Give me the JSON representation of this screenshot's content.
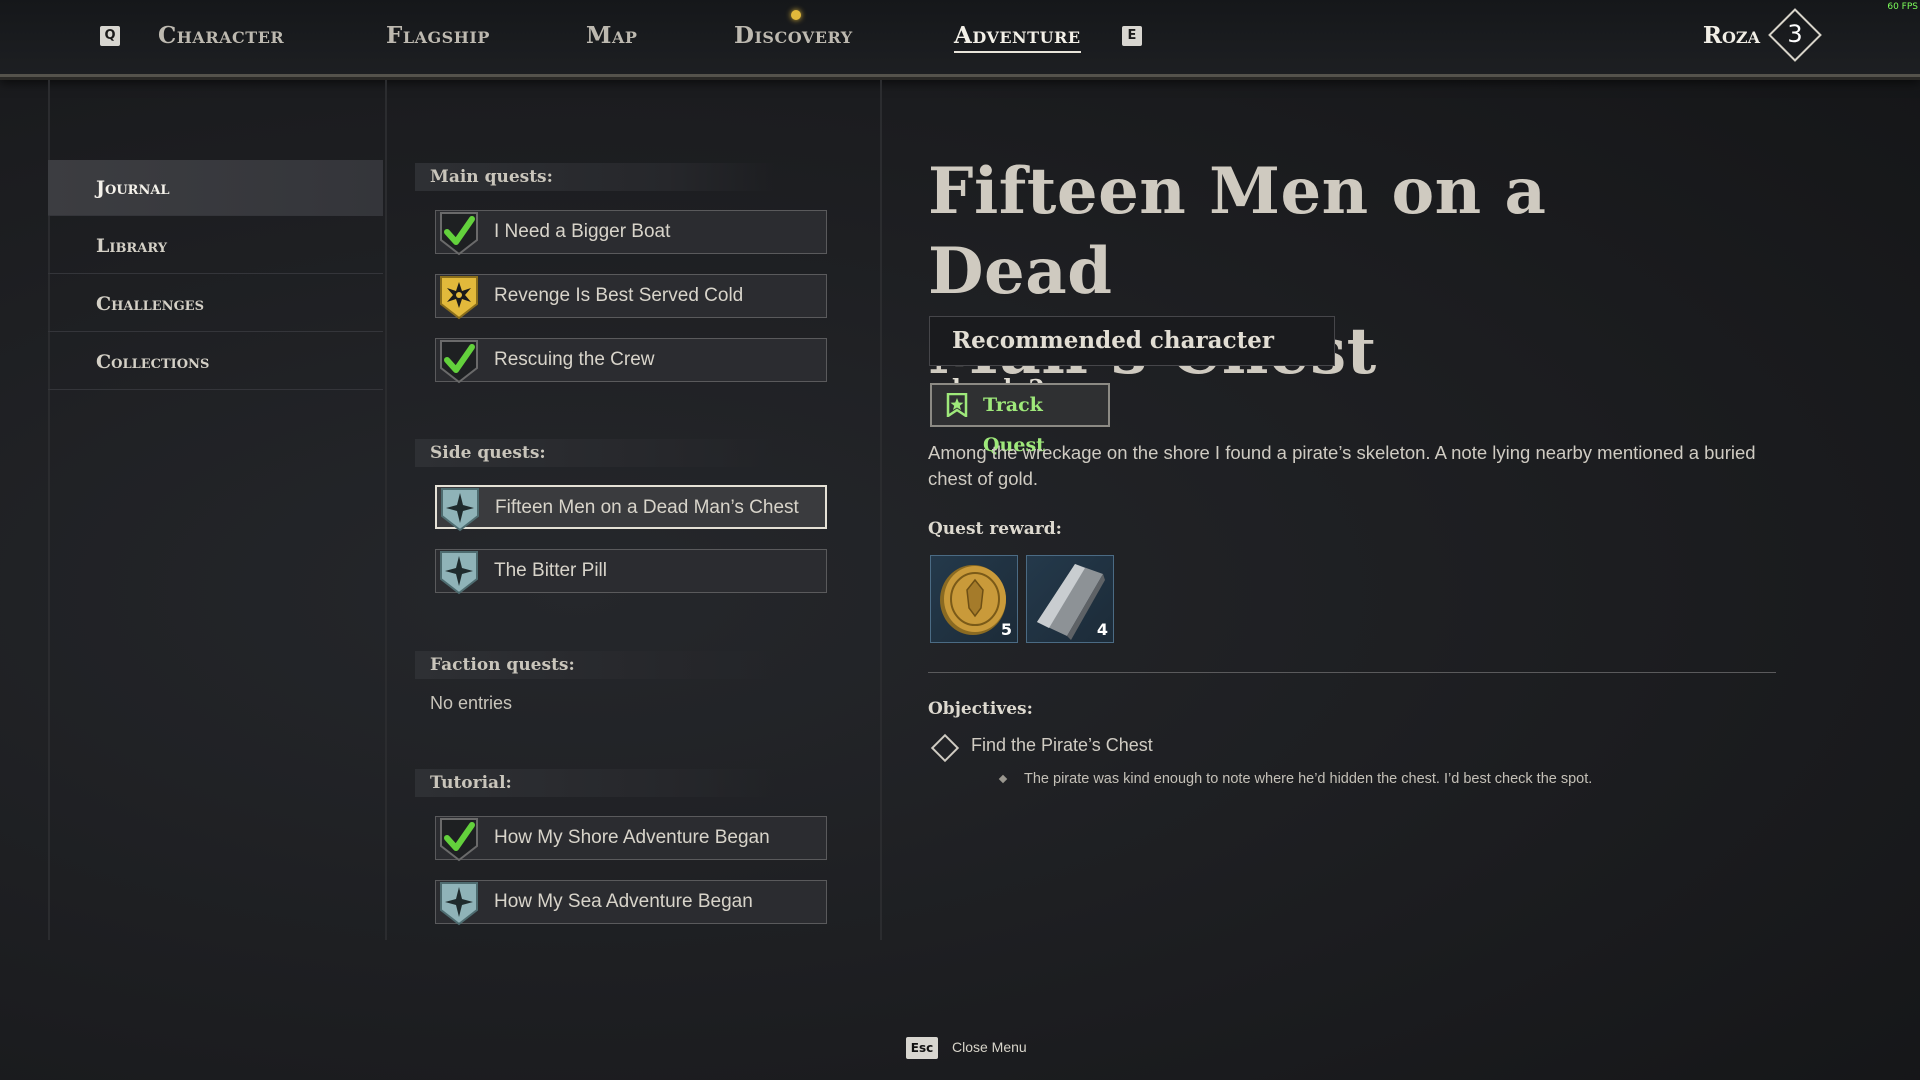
{
  "topbar": {
    "left_key": "Q",
    "right_key": "E",
    "tabs": [
      "Character",
      "Flagship",
      "Map",
      "Discovery",
      "Adventure"
    ],
    "active_tab": "Adventure",
    "player_name": "Roza",
    "player_level": "3",
    "fps": "60 FPS"
  },
  "sidebar": {
    "items": [
      "Journal",
      "Library",
      "Challenges",
      "Collections"
    ],
    "active": "Journal"
  },
  "quests": {
    "main_header": "Main quests:",
    "main": [
      {
        "label": "I Need a Bigger Boat",
        "status": "completed"
      },
      {
        "label": "Revenge Is Best Served Cold",
        "status": "active-main"
      },
      {
        "label": "Rescuing the Crew",
        "status": "completed"
      }
    ],
    "side_header": "Side quests:",
    "side": [
      {
        "label": "Fifteen Men on a Dead Man’s Chest",
        "status": "available",
        "selected": true
      },
      {
        "label": "The Bitter Pill",
        "status": "available"
      }
    ],
    "faction_header": "Faction quests:",
    "faction_empty": "No entries",
    "tutorial_header": "Tutorial:",
    "tutorial": [
      {
        "label": "How My Shore Adventure Began",
        "status": "completed"
      },
      {
        "label": "How My Sea Adventure Began",
        "status": "available"
      }
    ]
  },
  "detail": {
    "title_line1": "Fifteen Men on a Dead",
    "title_line2": "Man’s Chest",
    "recommended_level": "Recommended character level: 2",
    "track_button": "Track Quest",
    "description": "Among the wreckage on the shore I found a pirate’s skeleton. A note lying nearby mentioned a buried chest of gold.",
    "reward_header": "Quest reward:",
    "rewards": [
      {
        "icon": "gold-coin-icon",
        "count": "5"
      },
      {
        "icon": "silver-ingot-icon",
        "count": "4"
      }
    ],
    "objectives_header": "Objectives:",
    "objective": "Find the Pirate’s Chest",
    "objective_hint": "The pirate was kind enough to note where he’d hidden the chest. I’d best check the spot."
  },
  "footer": {
    "esc_key": "Esc",
    "esc_label": "Close Menu"
  },
  "colors": {
    "accent_green": "#9ee87a",
    "gold_badge": "#e2b93b",
    "teal_badge": "#8fb3b8"
  }
}
